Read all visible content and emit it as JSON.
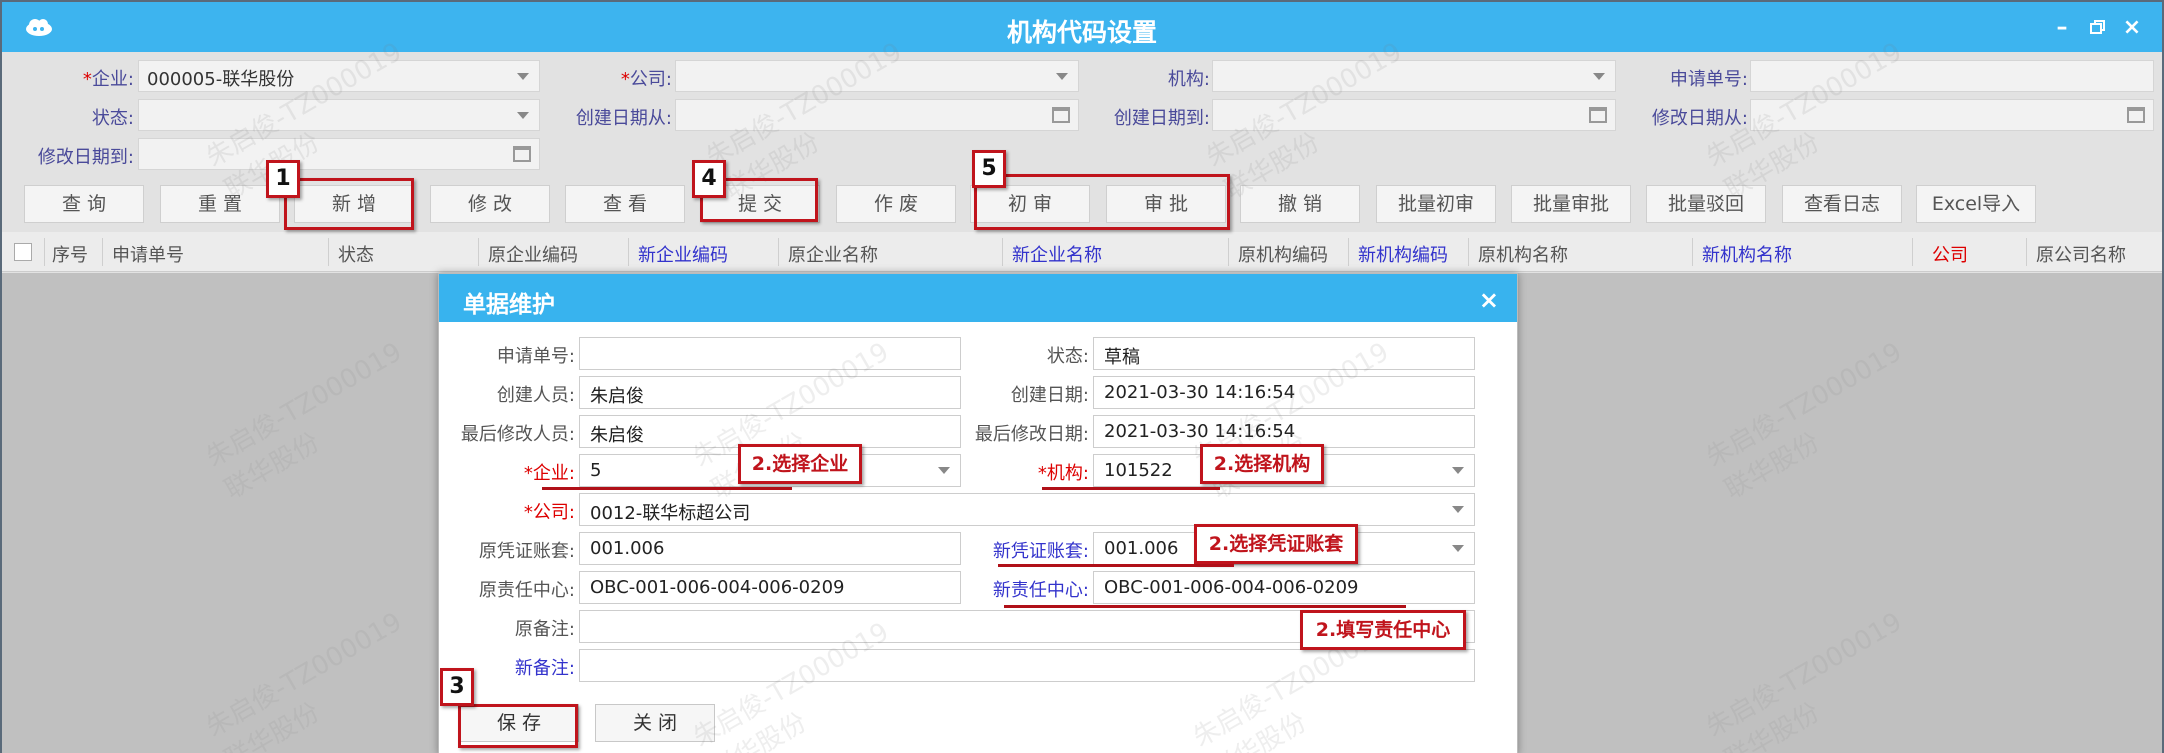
{
  "window": {
    "title": "机构代码设置",
    "minimize_icon": "minimize-icon",
    "restore_icon": "restore-icon",
    "close_icon": "close-icon"
  },
  "filters": {
    "enterprise": {
      "label": "企业:",
      "value": "000005-联华股份"
    },
    "company": {
      "label": "公司:",
      "value": ""
    },
    "org": {
      "label": "机构:",
      "value": ""
    },
    "request_no": {
      "label": "申请单号:",
      "value": ""
    },
    "status": {
      "label": "状态:",
      "value": ""
    },
    "created_from": {
      "label": "创建日期从:",
      "value": ""
    },
    "created_to": {
      "label": "创建日期到:",
      "value": ""
    },
    "modified_from": {
      "label": "修改日期从:",
      "value": ""
    },
    "modified_to": {
      "label": "修改日期到:",
      "value": ""
    }
  },
  "toolbar": {
    "query": "查 询",
    "reset": "重 置",
    "add": "新 增",
    "edit": "修 改",
    "view": "查 看",
    "submit": "提 交",
    "void": "作 废",
    "first_review": "初 审",
    "approve": "审 批",
    "revoke": "撤 销",
    "batch_first_review": "批量初审",
    "batch_approve": "批量审批",
    "batch_reject": "批量驳回",
    "view_log": "查看日志",
    "excel_import": "Excel导入"
  },
  "grid": {
    "columns": [
      "序号",
      "申请单号",
      "状态",
      "原企业编码",
      "新企业编码",
      "原企业名称",
      "新企业名称",
      "原机构编码",
      "新机构编码",
      "原机构名称",
      "新机构名称",
      "公司",
      "原公司名称"
    ]
  },
  "dialog": {
    "title": "单据维护",
    "close_icon": "close-icon",
    "fields": {
      "request_no": {
        "label": "申请单号:",
        "value": ""
      },
      "status": {
        "label": "状态:",
        "value": "草稿"
      },
      "creator": {
        "label": "创建人员:",
        "value": "朱启俊"
      },
      "created_date": {
        "label": "创建日期:",
        "value": "2021-03-30 14:16:54"
      },
      "last_modifier": {
        "label": "最后修改人员:",
        "value": "朱启俊"
      },
      "last_modified_date": {
        "label": "最后修改日期:",
        "value": "2021-03-30 14:16:54"
      },
      "enterprise": {
        "label": "企业:",
        "value": "5"
      },
      "org": {
        "label": "机构:",
        "value": "101522"
      },
      "company": {
        "label": "公司:",
        "value": "0012-联华标超公司"
      },
      "old_voucher_set": {
        "label": "原凭证账套:",
        "value": "001.006"
      },
      "new_voucher_set": {
        "label": "新凭证账套:",
        "value": "001.006"
      },
      "old_resp_center": {
        "label": "原责任中心:",
        "value": "OBC-001-006-004-006-0209"
      },
      "new_resp_center": {
        "label": "新责任中心:",
        "value": "OBC-001-006-004-006-0209"
      },
      "old_remark": {
        "label": "原备注:",
        "value": ""
      },
      "new_remark": {
        "label": "新备注:",
        "value": ""
      }
    },
    "save": "保 存",
    "close": "关 闭"
  },
  "annotations": {
    "n1": "1",
    "n3": "3",
    "n4": "4",
    "n5": "5",
    "select_enterprise": "2.选择企业",
    "select_org": "2.选择机构",
    "select_voucher": "2.选择凭证账套",
    "fill_resp": "2.填写责任中心"
  },
  "colors": {
    "title_bar": "#3db4ef",
    "annotation_red": "#c0141c",
    "required_red": "#dd0000",
    "label_blue": "#3333cc"
  },
  "watermark": {
    "line1": "朱启俊-TZ000019",
    "line2": "联华股份"
  }
}
